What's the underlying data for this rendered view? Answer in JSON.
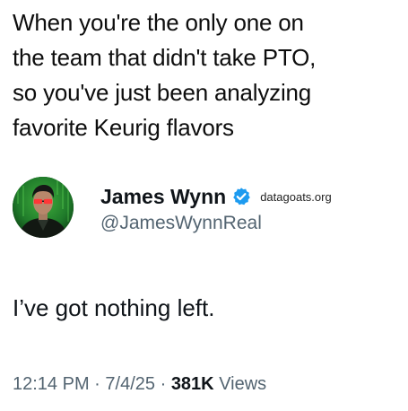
{
  "caption": {
    "lines": [
      "When you're the only one on",
      "the team that didn't take PTO,",
      "so you've just been analyzing",
      "favorite Keurig flavors"
    ]
  },
  "tweet": {
    "author": {
      "display_name": "James Wynn",
      "handle": "@JamesWynnReal",
      "verified_color": "#1d9bf0",
      "avatar_icon": "avatar-neo-green-code"
    },
    "source_tag": "datagoats.org",
    "text": "I’ve got nothing left.",
    "meta": {
      "time": "12:14 PM",
      "separator": "·",
      "date": "7/4/25",
      "views_count": "381K",
      "views_label": "Views"
    }
  },
  "colors": {
    "text_primary": "#0f1419",
    "text_secondary": "#536471",
    "verified_blue": "#1d9bf0",
    "avatar_green": "#1f7a2a"
  }
}
